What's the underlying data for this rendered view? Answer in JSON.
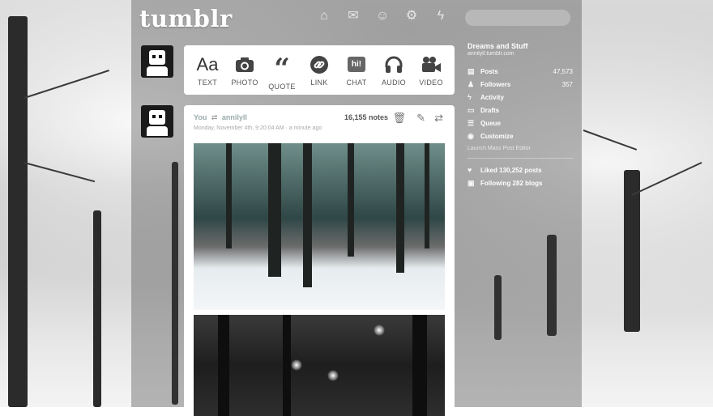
{
  "brand": "tumblr",
  "search": {
    "placeholder": ""
  },
  "top_icons": [
    "home-icon",
    "mail-icon",
    "user-icon",
    "gear-icon",
    "lightning-icon"
  ],
  "post_types": [
    {
      "label": "TEXT",
      "icon": "text-icon",
      "glyph": "Aa"
    },
    {
      "label": "PHOTO",
      "icon": "camera-icon",
      "glyph": "📷"
    },
    {
      "label": "QUOTE",
      "icon": "quote-icon",
      "glyph": "❝"
    },
    {
      "label": "LINK",
      "icon": "link-icon",
      "glyph": "🔗"
    },
    {
      "label": "CHAT",
      "icon": "chat-icon",
      "glyph": "hi!"
    },
    {
      "label": "AUDIO",
      "icon": "headphones-icon",
      "glyph": "🎧"
    },
    {
      "label": "VIDEO",
      "icon": "video-camera-icon",
      "glyph": "🎥"
    }
  ],
  "post": {
    "author": "You",
    "reblog_from": "annilyll",
    "notes": "16,155 notes",
    "date": "Monday, November 4th, 9:20:04 AM · a minute ago"
  },
  "sidebar": {
    "blog_title": "Dreams and Stuff",
    "blog_url": "annilyll.tumblr.com",
    "items": [
      {
        "label": "Posts",
        "count": "47,573",
        "icon": "posts-icon"
      },
      {
        "label": "Followers",
        "count": "357",
        "icon": "followers-icon"
      },
      {
        "label": "Activity",
        "count": "",
        "icon": "activity-icon"
      },
      {
        "label": "Drafts",
        "count": "",
        "icon": "drafts-icon"
      },
      {
        "label": "Queue",
        "count": "",
        "icon": "queue-icon"
      },
      {
        "label": "Customize",
        "count": "",
        "icon": "eye-icon"
      }
    ],
    "hint": "Launch Mass Post Editor",
    "liked": "Liked 130,252 posts",
    "following": "Following 282 blogs"
  }
}
